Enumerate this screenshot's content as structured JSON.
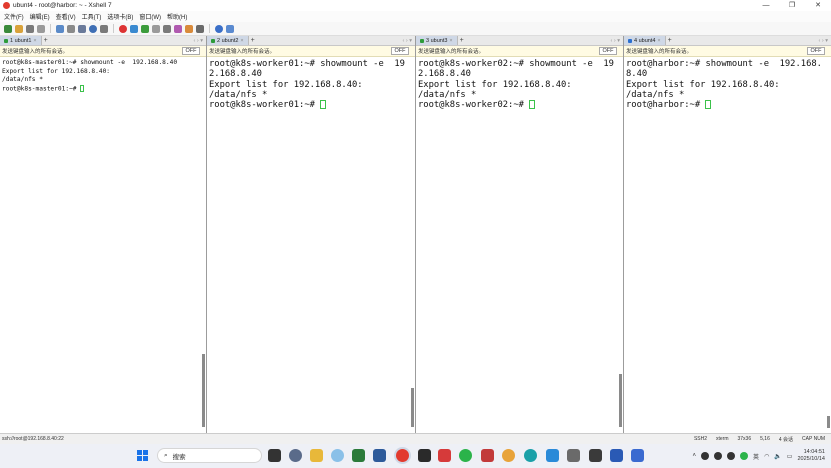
{
  "window": {
    "title": "ubunt4 - root@harbor: ~ - Xshell 7"
  },
  "menu": [
    "文件(F)",
    "编辑(E)",
    "查看(V)",
    "工具(T)",
    "选项卡(B)",
    "窗口(W)",
    "帮助(H)"
  ],
  "panes": [
    {
      "tab_label": "1 ubunt1",
      "send_text": "发送键盘输入的所有会话。",
      "off_label": "OFF",
      "lines": [
        "root@k8s-master01:~# showmount -e  192.168.8.40",
        "Export list for 192.168.8.40:",
        "/data/nfs *"
      ],
      "prompt": "root@k8s-master01:~# "
    },
    {
      "tab_label": "2 ubunt2",
      "send_text": "发送键盘输入的所有会话。",
      "off_label": "OFF",
      "lines": [
        "root@k8s-worker01:~# showmount -e  19",
        "2.168.8.40",
        "Export list for 192.168.8.40:",
        "/data/nfs *"
      ],
      "prompt": "root@k8s-worker01:~# "
    },
    {
      "tab_label": "3 ubunt3",
      "send_text": "发送键盘输入的所有会话。",
      "off_label": "OFF",
      "lines": [
        "root@k8s-worker02:~# showmount -e  19",
        "2.168.8.40",
        "Export list for 192.168.8.40:",
        "/data/nfs *"
      ],
      "prompt": "root@k8s-worker02:~# "
    },
    {
      "tab_label": "4 ubunt4",
      "send_text": "发送键盘输入的所有会话。",
      "off_label": "OFF",
      "lines": [
        "root@harbor:~# showmount -e  192.168.",
        "8.40",
        "Export list for 192.168.8.40:",
        "/data/nfs *"
      ],
      "prompt": "root@harbor:~# "
    }
  ],
  "status": {
    "connection": "ssh://root@192.168.8.40:22",
    "protocol": "SSH2",
    "term": "xterm",
    "size": "37x36",
    "cursor": "5,16",
    "sessions": "4 会话",
    "caps": "CAP NUM"
  },
  "taskbar": {
    "search_placeholder": "搜索",
    "ime": "英",
    "time": "14:04:51",
    "date": "2025/10/14"
  }
}
